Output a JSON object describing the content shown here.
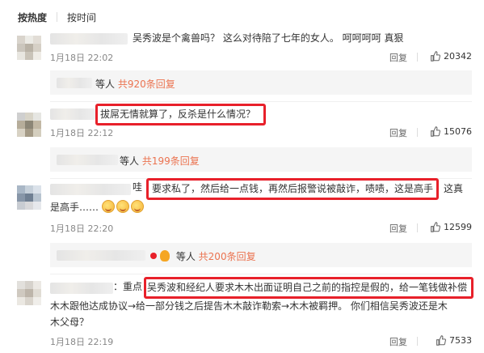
{
  "tabs": {
    "hot": "按热度",
    "time": "按时间"
  },
  "comments": [
    {
      "text": "吴秀波是个禽兽吗？ 这么对待陪了七年的女人。 呵呵呵呵 真狠",
      "time": "1月18日 22:02",
      "reply": "回复",
      "likes": "20342",
      "sub_people": "等人",
      "sub_count": "共920条回复"
    },
    {
      "text": "拔屌无情就算了，反杀是什么情况？",
      "time": "1月18日 22:12",
      "reply": "回复",
      "likes": "15076",
      "sub_people": "等人",
      "sub_count": "共199条回复"
    },
    {
      "prefix": "哇",
      "text": "要求私了，然后给一点钱，再然后报警说被敲诈，啧啧，这是高手",
      "suffix": "这真",
      "line2": "是高手……",
      "time": "1月18日 22:20",
      "reply": "回复",
      "likes": "12599",
      "sub_people": "等人",
      "sub_count": "共200条回复"
    },
    {
      "prefix": "：重点：",
      "text": "吴秀波和经纪人要求木木出面证明自己之前的指控是假的，给一笔钱做补偿",
      "line2": "木木跟他达成协议→给一部分钱之后提告木木敲诈勒索→木木被羁押。 你们相信吴秀波还是木",
      "line3": "木父母？",
      "time": "1月18日 22:19",
      "reply": "回复",
      "likes": "7533"
    }
  ],
  "colors": {
    "highlight": "#e8202a",
    "count": "#eb7350",
    "meta": "#888888"
  },
  "icons": {
    "like": "thumbs-up-icon"
  }
}
